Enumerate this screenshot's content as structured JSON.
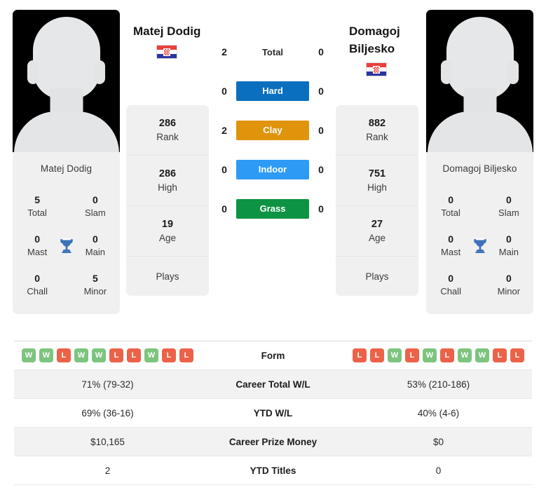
{
  "players": {
    "left": {
      "name": "Matej Dodig",
      "photo_caption": "Matej Dodig",
      "flag": "croatia-flag",
      "titles": {
        "total_value": "5",
        "total_label": "Total",
        "slam_value": "0",
        "slam_label": "Slam",
        "mast_value": "0",
        "mast_label": "Mast",
        "main_value": "0",
        "main_label": "Main",
        "chall_value": "0",
        "chall_label": "Chall",
        "minor_value": "5",
        "minor_label": "Minor"
      },
      "rank": {
        "rank_value": "286",
        "rank_label": "Rank",
        "high_value": "286",
        "high_label": "High",
        "age_value": "19",
        "age_label": "Age",
        "plays_label": "Plays",
        "plays_value": ""
      },
      "form": [
        "W",
        "W",
        "L",
        "W",
        "W",
        "L",
        "L",
        "W",
        "L",
        "L"
      ],
      "career_total_wl": "71% (79-32)",
      "ytd_wl": "69% (36-16)",
      "career_prize_money": "$10,165",
      "ytd_titles": "2"
    },
    "right": {
      "name": "Domagoj Biljesko",
      "photo_caption": "Domagoj Biljesko",
      "flag": "croatia-flag",
      "titles": {
        "total_value": "0",
        "total_label": "Total",
        "slam_value": "0",
        "slam_label": "Slam",
        "mast_value": "0",
        "mast_label": "Mast",
        "main_value": "0",
        "main_label": "Main",
        "chall_value": "0",
        "chall_label": "Chall",
        "minor_value": "0",
        "minor_label": "Minor"
      },
      "rank": {
        "rank_value": "882",
        "rank_label": "Rank",
        "high_value": "751",
        "high_label": "High",
        "age_value": "27",
        "age_label": "Age",
        "plays_label": "Plays",
        "plays_value": ""
      },
      "form": [
        "L",
        "L",
        "W",
        "L",
        "W",
        "L",
        "W",
        "W",
        "L",
        "L"
      ],
      "career_total_wl": "53% (210-186)",
      "ytd_wl": "40% (4-6)",
      "career_prize_money": "$0",
      "ytd_titles": "0"
    }
  },
  "head_to_head": [
    {
      "label": "Total",
      "left": "2",
      "right": "0",
      "style": "plain"
    },
    {
      "label": "Hard",
      "left": "0",
      "right": "0",
      "style": "hard"
    },
    {
      "label": "Clay",
      "left": "2",
      "right": "0",
      "style": "clay"
    },
    {
      "label": "Indoor",
      "left": "0",
      "right": "0",
      "style": "indoor"
    },
    {
      "label": "Grass",
      "left": "0",
      "right": "0",
      "style": "grass"
    }
  ],
  "stats_rows": [
    {
      "label": "Form",
      "left": "",
      "right": "",
      "type": "form"
    },
    {
      "label": "Career Total W/L",
      "left": "71% (79-32)",
      "right": "53% (210-186)",
      "type": "text"
    },
    {
      "label": "YTD W/L",
      "left": "69% (36-16)",
      "right": "40% (4-6)",
      "type": "text"
    },
    {
      "label": "Career Prize Money",
      "left": "$10,165",
      "right": "$0",
      "type": "text"
    },
    {
      "label": "YTD Titles",
      "left": "2",
      "right": "0",
      "type": "text"
    }
  ],
  "colors": {
    "hard": "#0b6fc0",
    "clay": "#e0940c",
    "indoor": "#2d9bf5",
    "grass": "#0d9344",
    "win": "#7dc47f",
    "loss": "#ec6248",
    "trophy": "#3d72b8",
    "card_bg": "#f0f0f0"
  }
}
